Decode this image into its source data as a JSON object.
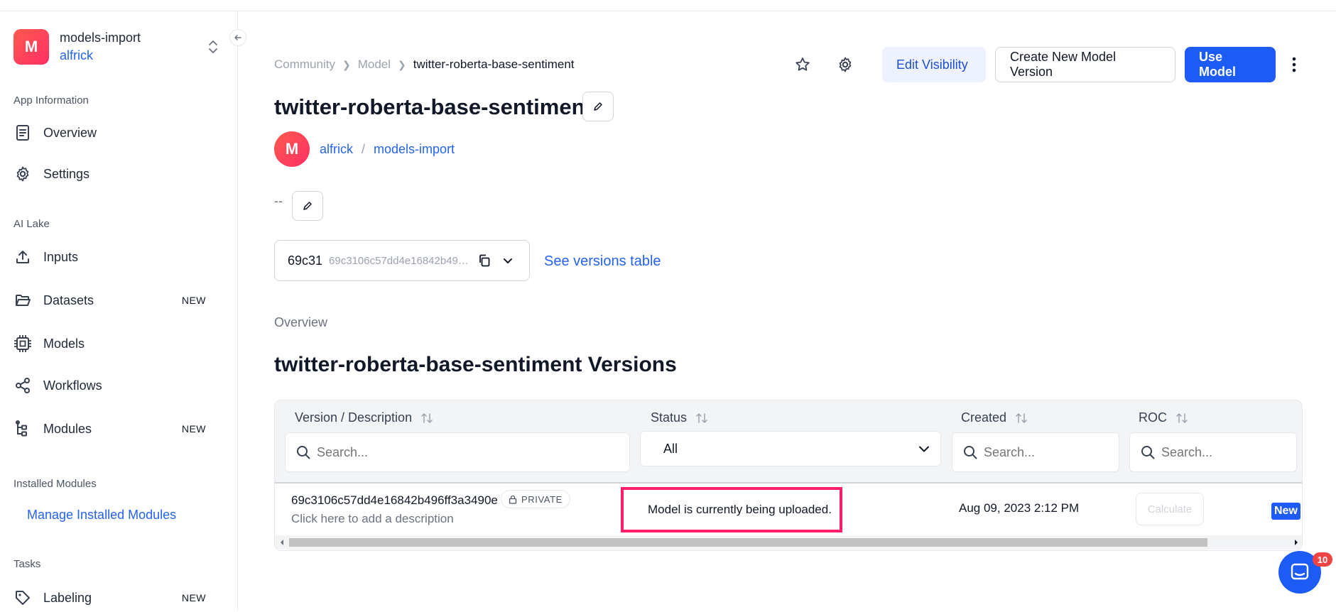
{
  "sidebar": {
    "app_initial": "M",
    "app_name": "models-import",
    "app_user": "alfrick",
    "sections": {
      "app_information": "App Information",
      "ai_lake": "AI Lake",
      "installed_modules": "Installed Modules",
      "tasks": "Tasks"
    },
    "items": {
      "overview": "Overview",
      "settings": "Settings",
      "inputs": "Inputs",
      "datasets": "Datasets",
      "datasets_badge": "NEW",
      "models": "Models",
      "workflows": "Workflows",
      "modules": "Modules",
      "modules_badge": "NEW",
      "labeling": "Labeling",
      "labeling_badge": "NEW"
    },
    "manage_installed_modules": "Manage Installed Modules"
  },
  "breadcrumb": {
    "community": "Community",
    "model": "Model",
    "current": "twitter-roberta-base-sentiment"
  },
  "header": {
    "edit_visibility": "Edit Visibility",
    "create_new_version": "Create New Model Version",
    "use_model": "Use Model"
  },
  "model": {
    "title": "twitter-roberta-base-sentiment",
    "owner_initial": "M",
    "owner_user": "alfrick",
    "owner_app": "models-import",
    "description": "--",
    "version_short": "69c31",
    "version_long": "69c3106c57dd4e16842b496ff3a3490e",
    "see_versions": "See versions table",
    "overview_label": "Overview",
    "versions_title": "twitter-roberta-base-sentiment Versions"
  },
  "table": {
    "columns": {
      "version": "Version / Description",
      "status": "Status",
      "created": "Created",
      "roc": "ROC"
    },
    "search_placeholder": "Search...",
    "status_filter": "All",
    "rows": [
      {
        "version_id": "69c3106c57dd4e16842b496ff3a3490e",
        "visibility": "PRIVATE",
        "description": "Click here to add a description",
        "status": "Model is currently being uploaded.",
        "created": "Aug 09, 2023 2:12 PM",
        "roc_action": "Calculate",
        "tag": "New"
      }
    ]
  },
  "chat": {
    "badge_count": "10"
  },
  "colors": {
    "primary": "#1d5bf5",
    "link": "#2563eb",
    "highlight": "#ff1f6b",
    "avatar_gradient_start": "#ff5a4e",
    "avatar_gradient_end": "#ff2e63"
  }
}
